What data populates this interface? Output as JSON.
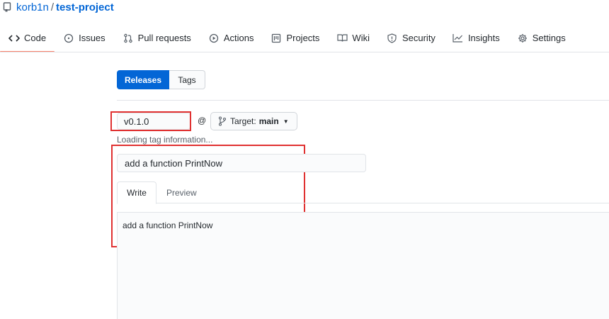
{
  "repo": {
    "owner": "korb1n",
    "separator": "/",
    "name": "test-project"
  },
  "tabs": [
    {
      "label": "Code",
      "icon": "code-icon",
      "active": true
    },
    {
      "label": "Issues",
      "icon": "issue-icon"
    },
    {
      "label": "Pull requests",
      "icon": "pull-request-icon"
    },
    {
      "label": "Actions",
      "icon": "play-icon"
    },
    {
      "label": "Projects",
      "icon": "project-icon"
    },
    {
      "label": "Wiki",
      "icon": "book-icon"
    },
    {
      "label": "Security",
      "icon": "shield-icon"
    },
    {
      "label": "Insights",
      "icon": "graph-icon"
    },
    {
      "label": "Settings",
      "icon": "gear-icon"
    }
  ],
  "subnav": {
    "releases": "Releases",
    "tags": "Tags"
  },
  "release_form": {
    "tag_value": "v0.1.0",
    "at_symbol": "@",
    "target_label": "Target:",
    "target_branch": "main",
    "loading_text": "Loading tag information...",
    "title_value": "add a function PrintNow",
    "write_tab": "Write",
    "preview_tab": "Preview",
    "description_value": "add a function PrintNow"
  },
  "colors": {
    "accent": "#0366d6",
    "tab_underline": "#f9826c",
    "highlight_box": "#e03131"
  }
}
